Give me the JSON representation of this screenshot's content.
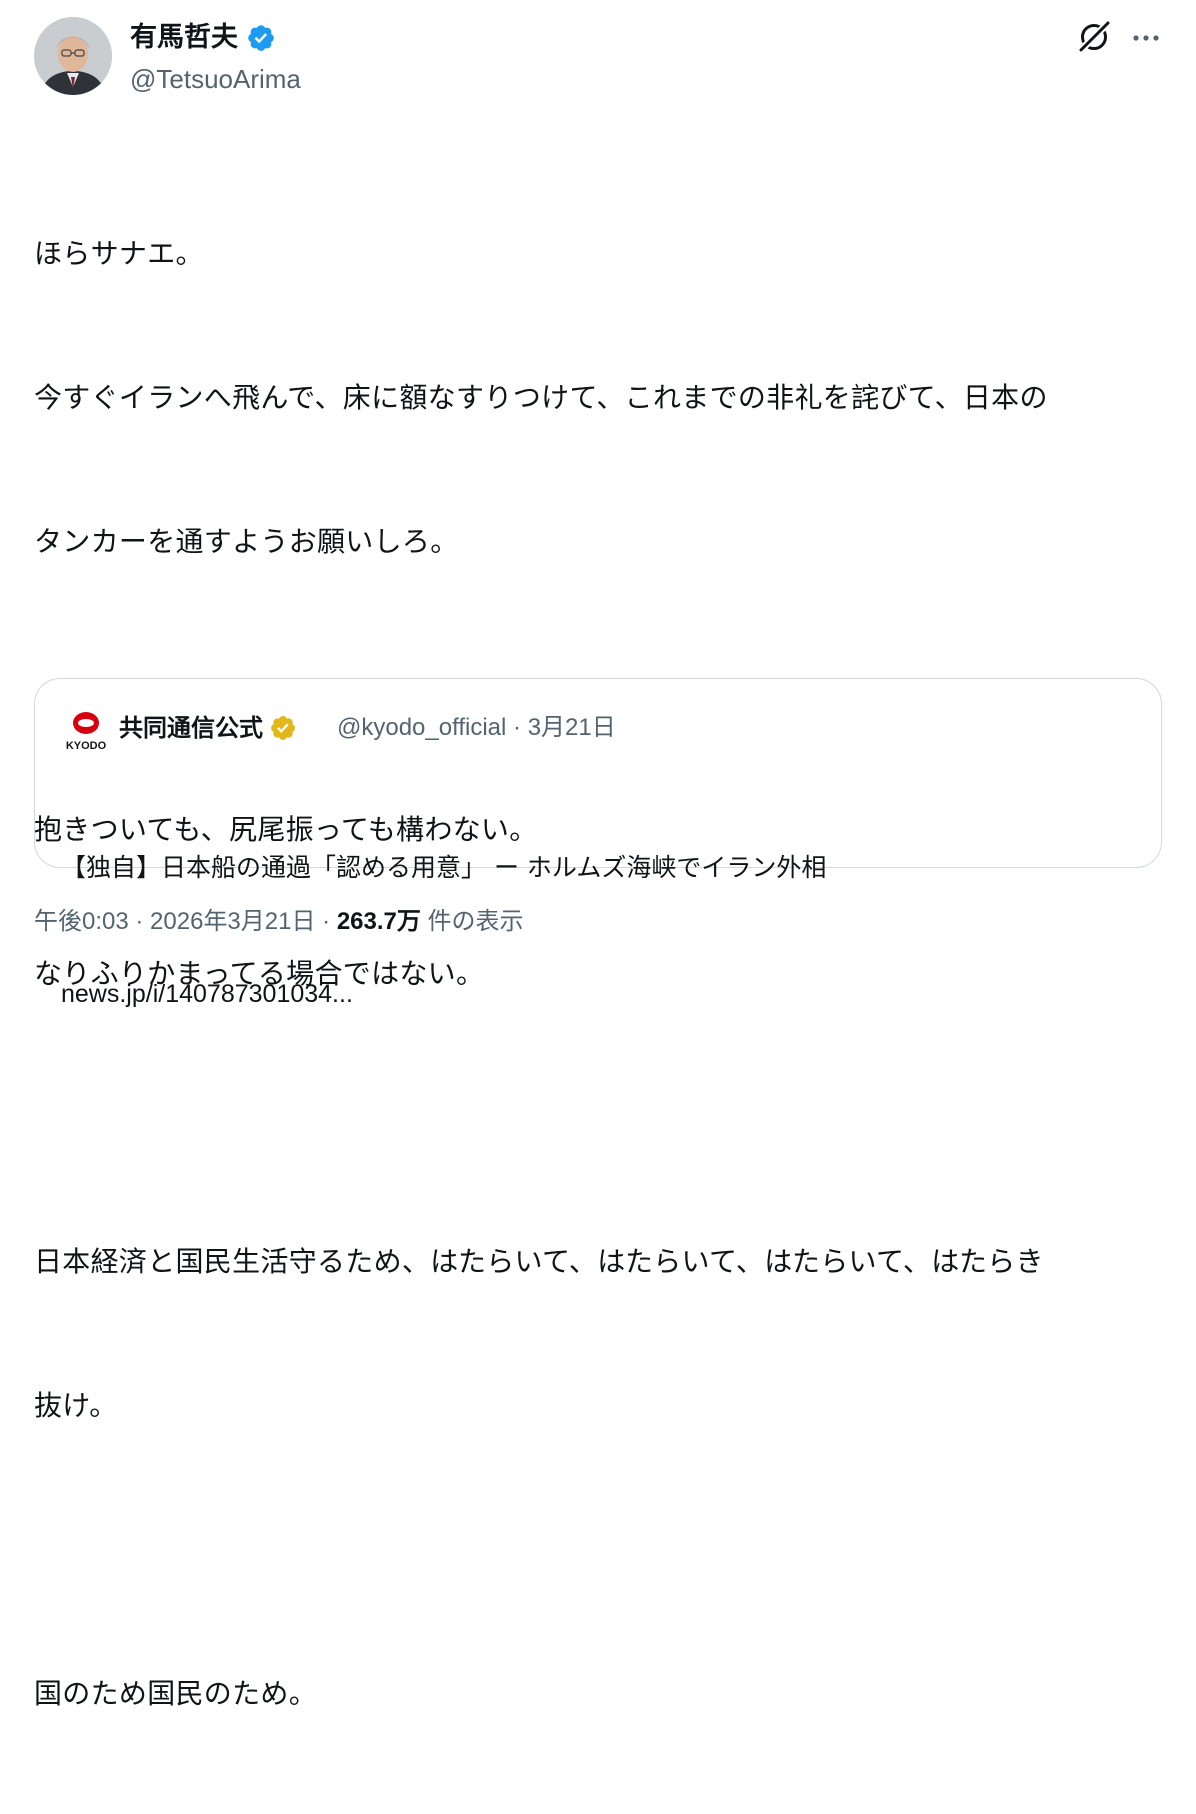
{
  "author": {
    "name": "有馬哲夫",
    "handle": "@TetsuoArima",
    "verified_color": "#1d9bf0"
  },
  "header_icons": [
    "grok-icon",
    "more-icon"
  ],
  "tweet": {
    "lines": [
      "ほらサナエ。",
      "今すぐイランへ飛んで、床に額なすりつけて、これまでの非礼を詫びて、日本の",
      "タンカーを通すようお願いしろ。",
      "",
      "抱きついても、尻尾振っても構わない。",
      "なりふりかまってる場合ではない。",
      "",
      "日本経済と国民生活守るため、はたらいて、はたらいて、はたらいて、はたらき",
      "抜け。",
      "",
      "国のため国民のため。"
    ]
  },
  "quote": {
    "logo_text": "KYODO",
    "name": "共同通信公式",
    "handle": "@kyodo_official",
    "separator": " · ",
    "date": "3月21日",
    "text": "【独自】日本船の通過「認める用意」 ー ホルムズ海峡でイラン外相",
    "url": "news.jp/i/140787301034..."
  },
  "footer": {
    "time": "午後0:03",
    "sep1": " · ",
    "date": "2026年3月21日",
    "sep2": " · ",
    "views": "263.7万",
    "views_label": " 件の表示"
  },
  "colors": {
    "text": "#0f1419",
    "secondary": "#536471",
    "border": "#cfd9de",
    "blue_badge": "#1d9bf0",
    "gold_badge": "#e2b719",
    "kyodo_red": "#d7000f"
  }
}
